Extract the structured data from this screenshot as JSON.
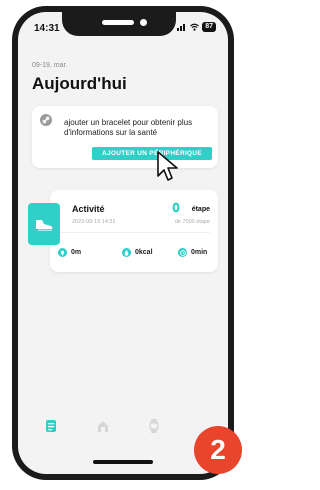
{
  "status_bar": {
    "time": "14:31",
    "battery": "87"
  },
  "header": {
    "date": "09-19, mar.",
    "title": "Aujourd'hui"
  },
  "bracelet_card": {
    "text": "ajouter un bracelet pour obtenir plus d'informations sur la santé",
    "button_label": "AJOUTER UN PÉRIPHÉRIQUE"
  },
  "activity_card": {
    "title": "Activité",
    "datetime": "2023-09-19 14:31",
    "steps_label": "étape",
    "goal": "de 7000 étape",
    "metrics": [
      {
        "icon": "location-icon",
        "value": "0m"
      },
      {
        "icon": "flame-icon",
        "value": "0kcal"
      },
      {
        "icon": "clock-icon",
        "value": "0min"
      }
    ]
  },
  "tab_bar": {
    "tabs": [
      "today-tab",
      "health-tab",
      "device-tab",
      "profile-tab"
    ],
    "active": "today-tab"
  },
  "step_badge": "2",
  "colors": {
    "accent": "#2fd0c8",
    "badge": "#e8452c"
  }
}
